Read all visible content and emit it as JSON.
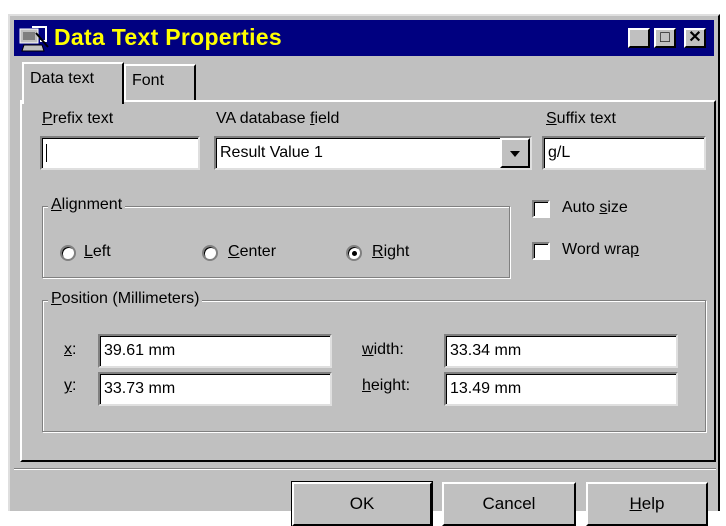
{
  "window": {
    "title": "Data Text Properties",
    "title_color": "#ffff00",
    "titlebar_color": "#000080",
    "controls": {
      "minimize": "_",
      "maximize": "□",
      "close": "✕"
    }
  },
  "tabs": [
    {
      "label": "Data text",
      "active": true
    },
    {
      "label": "Font",
      "active": false
    }
  ],
  "prefix": {
    "label_u": "P",
    "label_rest": "refix text",
    "value": ""
  },
  "va_field": {
    "label_a": "VA database ",
    "label_u": "f",
    "label_b": "ield",
    "value": "Result Value 1"
  },
  "suffix": {
    "label_u": "S",
    "label_rest": "uffix text",
    "value": "g/L"
  },
  "alignment": {
    "title_u": "A",
    "title_rest": "lignment",
    "options": [
      {
        "label_u": "L",
        "label_rest": "eft",
        "checked": false
      },
      {
        "label_u": "C",
        "label_rest": "enter",
        "checked": false
      },
      {
        "label_u": "R",
        "label_rest": "ight",
        "checked": true
      }
    ]
  },
  "auto_size": {
    "label_a": "Auto ",
    "label_u": "s",
    "label_b": "ize",
    "checked": false
  },
  "word_wrap": {
    "label_a": "Word wra",
    "label_u": "p",
    "label_b": "",
    "checked": false
  },
  "position": {
    "title_u": "P",
    "title_rest": "osition (Millimeters)",
    "x": {
      "label_u": "x",
      "label_rest": ":",
      "value": "39.61 mm"
    },
    "y": {
      "label_u": "y",
      "label_rest": ":",
      "value": "33.73 mm"
    },
    "width": {
      "label_u": "w",
      "label_rest": "idth:",
      "value": "33.34 mm"
    },
    "height": {
      "label_u": "h",
      "label_rest": "eight:",
      "value": "13.49 mm"
    }
  },
  "buttons": {
    "ok": "OK",
    "cancel": "Cancel",
    "help_u": "H",
    "help_rest": "elp"
  }
}
